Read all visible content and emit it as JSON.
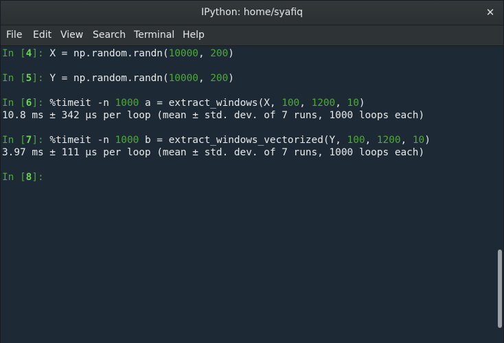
{
  "window": {
    "title": "IPython: home/syafiq",
    "close_glyph": "✕"
  },
  "menu": [
    "File",
    "Edit",
    "View",
    "Search",
    "Terminal",
    "Help"
  ],
  "lines": [
    {
      "prompt_pre": "In [",
      "n": "4",
      "prompt_post": "]: ",
      "code": [
        {
          "t": "X = np.random.randn(",
          "c": "n"
        },
        {
          "t": "10000",
          "c": "g"
        },
        {
          "t": ", ",
          "c": "n"
        },
        {
          "t": "200",
          "c": "g"
        },
        {
          "t": ")",
          "c": "n"
        }
      ]
    },
    {
      "prompt_pre": "In [",
      "n": "5",
      "prompt_post": "]: ",
      "code": [
        {
          "t": "Y = np.random.randn(",
          "c": "n"
        },
        {
          "t": "10000",
          "c": "g"
        },
        {
          "t": ", ",
          "c": "n"
        },
        {
          "t": "200",
          "c": "g"
        },
        {
          "t": ")",
          "c": "n"
        }
      ]
    },
    {
      "prompt_pre": "In [",
      "n": "6",
      "prompt_post": "]: ",
      "code": [
        {
          "t": "%timeit -n ",
          "c": "n"
        },
        {
          "t": "1000",
          "c": "g"
        },
        {
          "t": " a = extract_windows(X, ",
          "c": "n"
        },
        {
          "t": "100",
          "c": "g"
        },
        {
          "t": ", ",
          "c": "n"
        },
        {
          "t": "1200",
          "c": "g"
        },
        {
          "t": ", ",
          "c": "n"
        },
        {
          "t": "10",
          "c": "g"
        },
        {
          "t": ")",
          "c": "n"
        }
      ]
    },
    {
      "output": "10.8 ms ± 342 µs per loop (mean ± std. dev. of 7 runs, 1000 loops each)"
    },
    {
      "prompt_pre": "In [",
      "n": "7",
      "prompt_post": "]: ",
      "code": [
        {
          "t": "%timeit -n ",
          "c": "n"
        },
        {
          "t": "1000",
          "c": "g"
        },
        {
          "t": " b = extract_windows_vectorized(Y, ",
          "c": "n"
        },
        {
          "t": "100",
          "c": "g"
        },
        {
          "t": ", ",
          "c": "n"
        },
        {
          "t": "1200",
          "c": "g"
        },
        {
          "t": ", ",
          "c": "n"
        },
        {
          "t": "10",
          "c": "g"
        },
        {
          "t": ")",
          "c": "n"
        }
      ]
    },
    {
      "output": "3.97 ms ± 111 µs per loop (mean ± std. dev. of 7 runs, 1000 loops each)"
    },
    {
      "prompt_pre": "In [",
      "n": "8",
      "prompt_post": "]: ",
      "code": []
    }
  ],
  "colors": {
    "background": "#1d2a36",
    "prompt": "#4fa83a",
    "number_literal": "#4fa83a",
    "text": "#e8eaea"
  }
}
